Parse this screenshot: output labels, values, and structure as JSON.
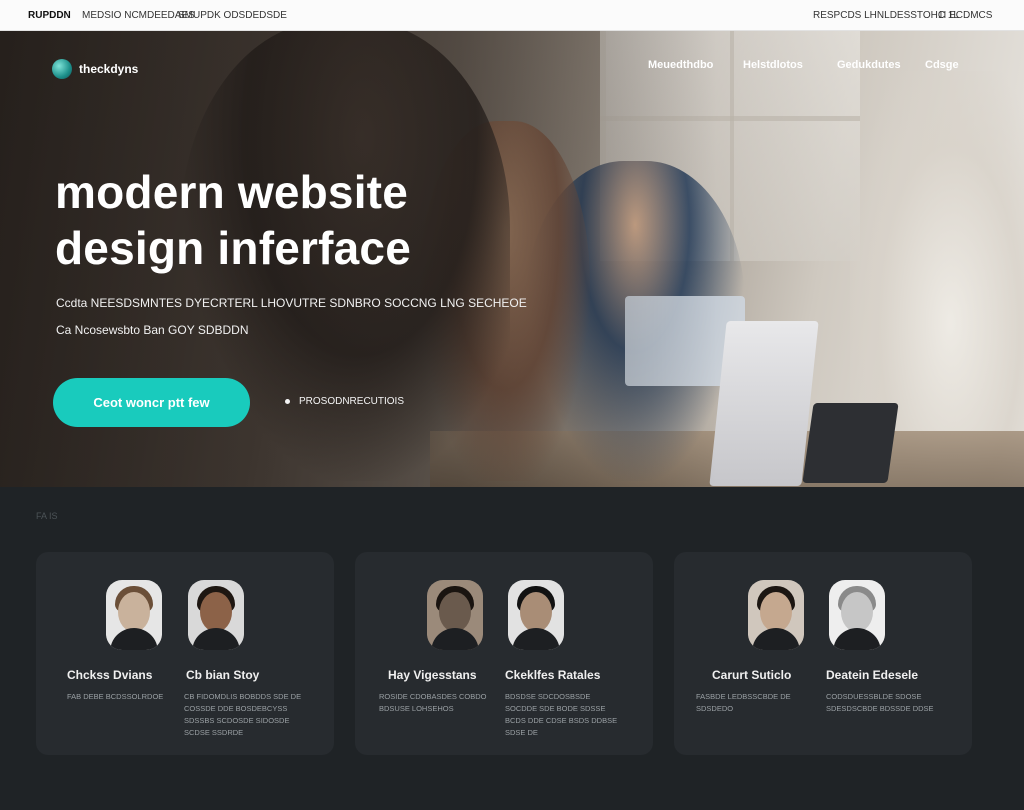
{
  "topbar": {
    "brand": "RUPDDN",
    "links_left": [
      "MEDSIO NCMDEEDAES",
      "SMUPDK ODSDEDSDE"
    ],
    "links_right": [
      "RESPCDS LHNLDESSTOHC 1L",
      "1I ECDMCS"
    ]
  },
  "header": {
    "logo_text": "theckdyns",
    "nav": [
      "Meuedthdbo",
      "Helstdlotos",
      "Gedukdutes",
      "Cdsge"
    ]
  },
  "hero": {
    "headline_line1": "modern website",
    "headline_line2": "design inferface",
    "sub_line1": "Ccdta NEESDSMNTES DYECRTERL LHOVUTRE SDNBRO SOCCNG LNG SECHEOE",
    "sub_line2": "Ca Ncosewsbto Ban GOY SDBDDN",
    "cta_label": "Ceot woncr ptt few",
    "secondary_link": "PROSODNRECUTIOIS"
  },
  "section": {
    "label": "FA IS"
  },
  "team": [
    {
      "members": [
        {
          "name": "Chckss Dvians",
          "bio": "FAB DEBE BCDSSOLRDOE",
          "face": "#c9b29c",
          "hair": "#6b4f38",
          "bg": "#e6e6e6"
        },
        {
          "name": "Cb bian Stoy",
          "bio": "CB FIDOMDLIS BOBDDS SDE DE COSSDE DDE BOSDEBCYSS SDSSBS SCDOSDE SIDOSDE SCDSE SSDRDE",
          "face": "#8c6248",
          "hair": "#1e1712",
          "bg": "#d9d9d9"
        }
      ]
    },
    {
      "members": [
        {
          "name": "Hay Vigesstans",
          "bio": "ROSIDE CDOBASDES COBDO BDSUSE LOHSEHOS",
          "face": "#6a5a4d",
          "hair": "#1a1410",
          "bg": "#9b8a7a"
        },
        {
          "name": "Ckeklfes Ratales",
          "bio": "BDSDSE SDCDOSBSDE SOCDDE SDE BODE SDSSE BCDS DDE CDSE BSDS DDBSE SDSE DE",
          "face": "#a98d76",
          "hair": "#121212",
          "bg": "#e2e2e2"
        }
      ]
    },
    {
      "members": [
        {
          "name": "Carurt Suticlo",
          "bio": "FASBDE LEDBSSCBDE DE SDSDEDO",
          "face": "#c5a88f",
          "hair": "#1c1612",
          "bg": "#d0c7bd"
        },
        {
          "name": "Deatein Edesele",
          "bio": "CODSDUESSBLDE SDOSE SDESDSCBDE BDSSDE DDSE",
          "face": "#c6c6c6",
          "hair": "#8a8a8a",
          "bg": "#eeeeee"
        }
      ]
    }
  ],
  "colors": {
    "accent": "#19cbbd",
    "page_bg": "#1f2326",
    "card_bg": "#272b2f"
  }
}
